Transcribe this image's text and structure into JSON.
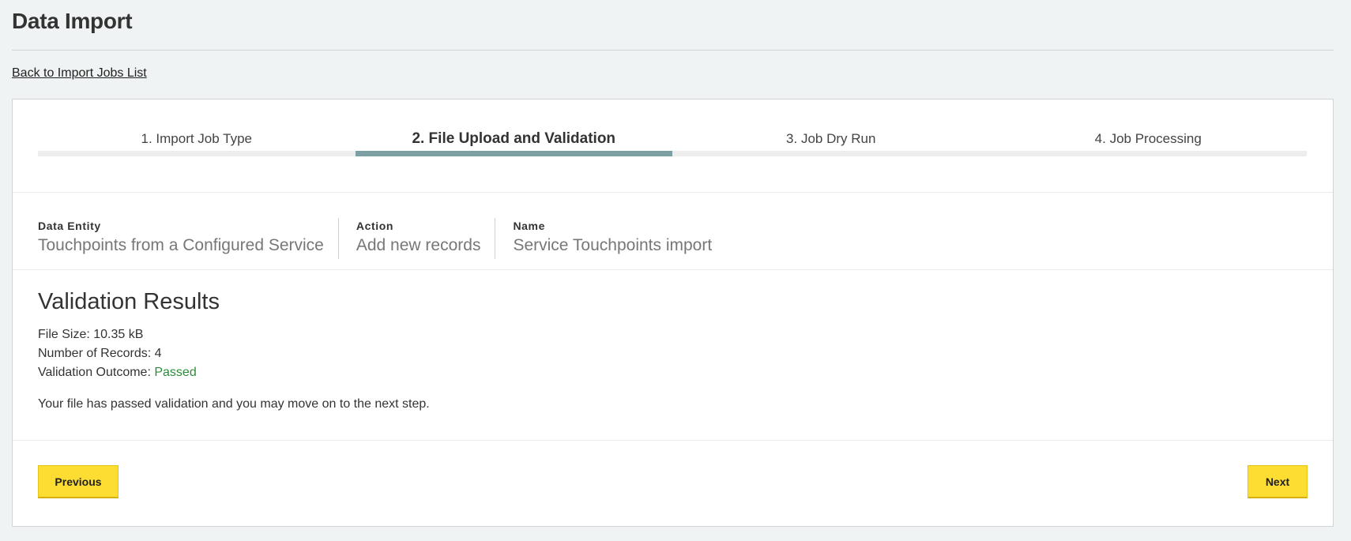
{
  "page": {
    "title": "Data Import",
    "back_link": "Back to Import Jobs List"
  },
  "steps": [
    {
      "label": "1. Import Job Type",
      "active": false
    },
    {
      "label": "2. File Upload and Validation",
      "active": true
    },
    {
      "label": "3. Job Dry Run",
      "active": false
    },
    {
      "label": "4. Job Processing",
      "active": false
    }
  ],
  "job_info": {
    "data_entity": {
      "label": "Data Entity",
      "value": "Touchpoints from a Configured Service"
    },
    "action": {
      "label": "Action",
      "value": "Add new records"
    },
    "name": {
      "label": "Name",
      "value": "Service Touchpoints import"
    }
  },
  "validation": {
    "title": "Validation Results",
    "file_size_label": "File Size:",
    "file_size_value": "10.35 kB",
    "records_label": "Number of Records:",
    "records_value": "4",
    "outcome_label": "Validation Outcome:",
    "outcome_value": "Passed",
    "outcome_color": "#2e8b3a",
    "message": "Your file has passed validation and you may move on to the next step."
  },
  "buttons": {
    "previous": "Previous",
    "next": "Next",
    "accent_color": "#fedd33"
  }
}
